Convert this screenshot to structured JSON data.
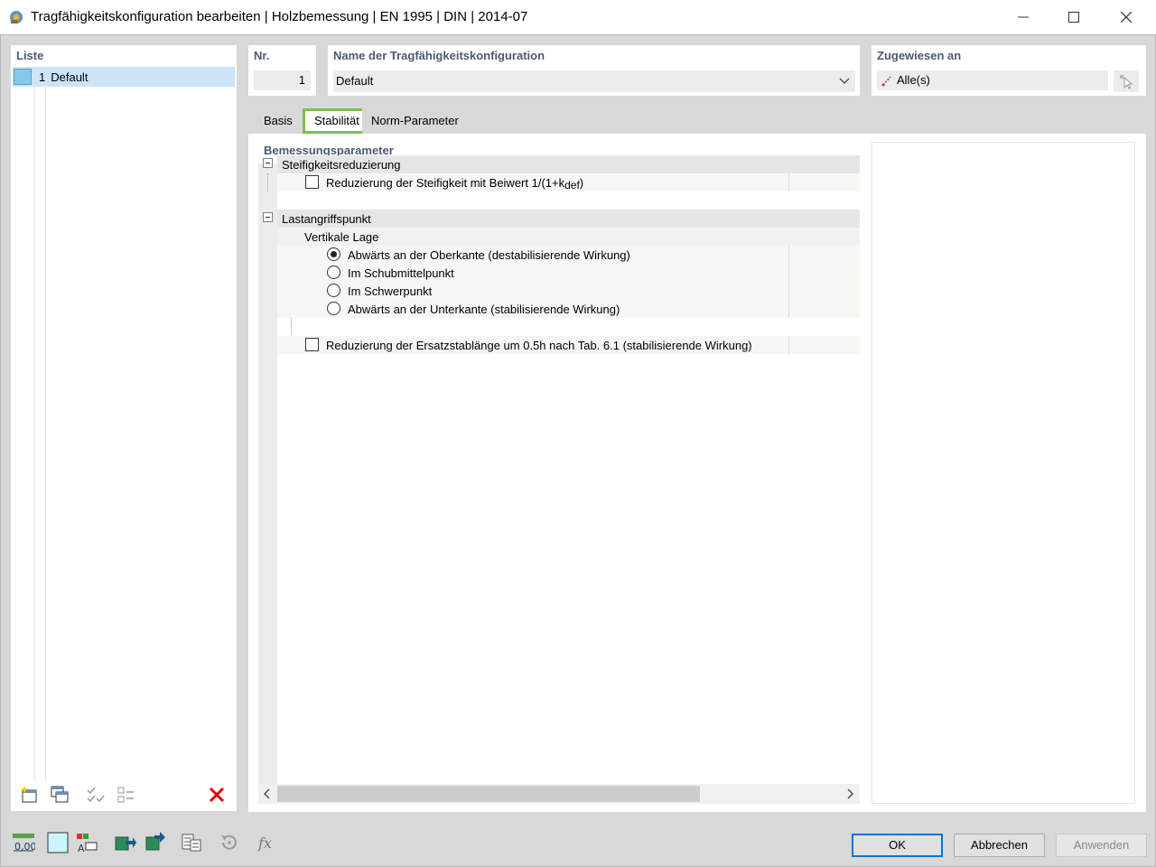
{
  "window": {
    "title": "Tragfähigkeitskonfiguration bearbeiten | Holzbemessung | EN 1995 | DIN | 2014-07",
    "minimize_icon": "minimize-icon",
    "maximize_icon": "maximize-icon",
    "close_icon": "close-icon"
  },
  "list": {
    "label": "Liste",
    "items": [
      {
        "num": "1",
        "name": "Default",
        "color": "#86c8ea"
      }
    ],
    "tools": [
      "new-item-icon",
      "copy-item-icon",
      "check-all-icon",
      "uncheck-all-icon",
      "delete-icon"
    ]
  },
  "nr": {
    "label": "Nr.",
    "value": "1"
  },
  "config_name": {
    "label": "Name der Tragfähigkeitskonfiguration",
    "value": "Default"
  },
  "assigned": {
    "label": "Zugewiesen an",
    "value": "Alle(s)"
  },
  "tabs": [
    {
      "label": "Basis",
      "active": false
    },
    {
      "label": "Stabilität",
      "active": true
    },
    {
      "label": "Norm-Parameter",
      "active": false
    }
  ],
  "design": {
    "label": "Bemessungsparameter",
    "groups": {
      "stiffness": {
        "label": "Steifigkeitsreduzierung",
        "option_label": "Reduzierung der Steifigkeit mit Beiwert 1/(1+k",
        "option_sub": "def",
        "option_suffix": ")",
        "checked": false
      },
      "load_point": {
        "label": "Lastangriffspunkt",
        "vertical": {
          "label": "Vertikale Lage",
          "options": [
            {
              "label": "Abwärts an der Oberkante (destabilisierende Wirkung)",
              "selected": true
            },
            {
              "label": "Im Schubmittelpunkt",
              "selected": false
            },
            {
              "label": "Im Schwerpunkt",
              "selected": false
            },
            {
              "label": "Abwärts an der Unterkante (stabilisierende Wirkung)",
              "selected": false
            }
          ]
        },
        "reduction_label": "Reduzierung der Ersatzstablänge um 0.5h nach Tab. 6.1 (stabilisierende Wirkung)",
        "reduction_checked": false
      }
    }
  },
  "bottom": {
    "tools": [
      "units-icon",
      "color-box-icon",
      "display-icon",
      "import-icon",
      "export-icon",
      "table-icon",
      "reset-icon",
      "formula-icon"
    ],
    "ok": "OK",
    "cancel": "Abbrechen",
    "apply": "Anwenden"
  },
  "colors": {
    "accent": "#7ac14a",
    "label": "#4a5a74",
    "selection": "#cce4f7",
    "primary_border": "#0078d7"
  }
}
